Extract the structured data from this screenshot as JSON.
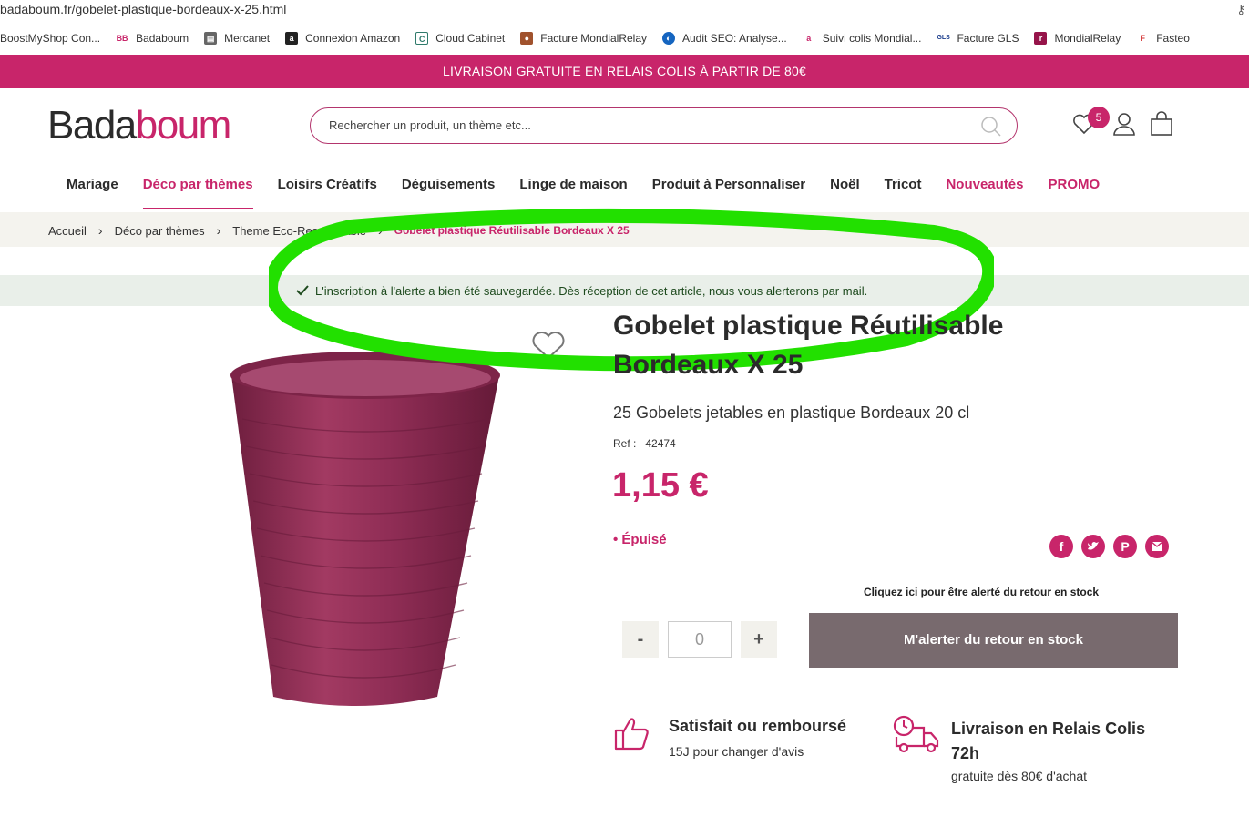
{
  "browser": {
    "url": "badaboum.fr/gobelet-plastique-bordeaux-x-25.html",
    "bookmarks": [
      {
        "label": "BoostMyShop Con...",
        "icon": "boostmyshop-icon",
        "color": "#ffffff"
      },
      {
        "label": "Badaboum",
        "icon": "badaboum-favicon",
        "color": "#c8256a"
      },
      {
        "label": "Mercanet",
        "icon": "mercanet-icon",
        "color": "#555555"
      },
      {
        "label": "Connexion Amazon",
        "icon": "amazon-icon",
        "color": "#222222"
      },
      {
        "label": "Cloud Cabinet",
        "icon": "cloud-cabinet-icon",
        "color": "#2f7a6b"
      },
      {
        "label": "Facture MondialRelay",
        "icon": "mondialrelay-icon",
        "color": "#a0522d"
      },
      {
        "label": "Audit SEO: Analyse...",
        "icon": "audit-seo-icon",
        "color": "#1565c0"
      },
      {
        "label": "Suivi colis Mondial...",
        "icon": "suivi-colis-icon",
        "color": "#c8256a"
      },
      {
        "label": "Facture GLS",
        "icon": "gls-icon",
        "color": "#1a3c8c"
      },
      {
        "label": "MondialRelay",
        "icon": "mondialrelay-icon",
        "color": "#96144a"
      },
      {
        "label": "Fasteo",
        "icon": "fasteo-icon",
        "color": "#d32f2f"
      }
    ]
  },
  "promo_banner": "LIVRAISON GRATUITE EN RELAIS COLIS À PARTIR DE 80€",
  "header": {
    "logo_part1": "Bada",
    "logo_part2": "boum",
    "search_placeholder": "Rechercher un produit, un thème etc...",
    "wishlist_count": "5"
  },
  "nav": [
    {
      "label": "Mariage"
    },
    {
      "label": "Déco par thèmes"
    },
    {
      "label": "Loisirs Créatifs"
    },
    {
      "label": "Déguisements"
    },
    {
      "label": "Linge de maison"
    },
    {
      "label": "Produit à Personnaliser"
    },
    {
      "label": "Noël"
    },
    {
      "label": "Tricot"
    },
    {
      "label": "Nouveautés"
    },
    {
      "label": "PROMO"
    }
  ],
  "breadcrumb": [
    "Accueil",
    "Déco par thèmes",
    "Theme Eco-Responsable",
    "Gobelet plastique Réutilisable Bordeaux X 25"
  ],
  "alert_message": "L'inscription à l'alerte a bien été sauvegardée. Dès réception de cet article, nous vous alerterons par mail.",
  "product": {
    "title": "Gobelet plastique Réutilisable Bordeaux X 25",
    "subtitle": "25 Gobelets jetables en plastique Bordeaux 20 cl",
    "ref_label": "Ref :",
    "ref_value": "42474",
    "price": "1,15 €",
    "stock_status": "• Épuisé",
    "alert_hint": "Cliquez ici pour être alerté du retour en stock",
    "qty_minus": "-",
    "qty_value": "0",
    "qty_plus": "+",
    "notify_button": "M'alerter du retour en stock"
  },
  "guarantees": {
    "g1_title": "Satisfait ou remboursé",
    "g1_text": "15J pour changer d'avis",
    "g2_title": "Livraison en Relais Colis 72h",
    "g2_text": "gratuite dès 80€ d'achat"
  },
  "colors": {
    "brand": "#c8256a",
    "annotation": "#22e000",
    "button": "#786a6e"
  }
}
